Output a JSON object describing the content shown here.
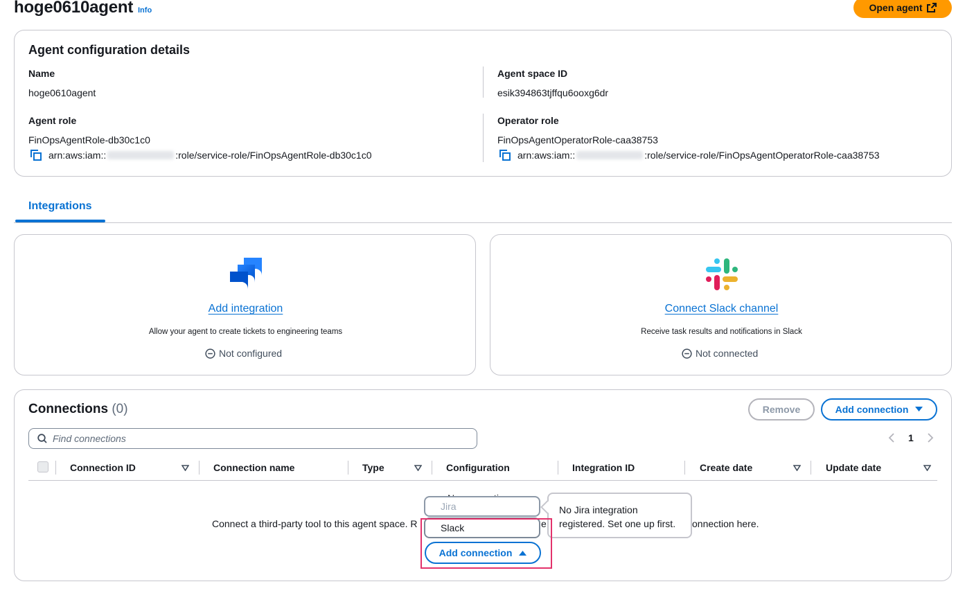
{
  "header": {
    "title": "hoge0610agent",
    "info_label": "Info",
    "open_agent_label": "Open agent"
  },
  "config": {
    "heading": "Agent configuration details",
    "name_label": "Name",
    "name_value": "hoge0610agent",
    "agent_space_id_label": "Agent space ID",
    "agent_space_id_value": "esik394863tjffqu6ooxg6dr",
    "agent_role_label": "Agent role",
    "agent_role_value": "FinOpsAgentRole-db30c1c0",
    "agent_role_arn_prefix": "arn:aws:iam::",
    "agent_role_arn_suffix": ":role/service-role/FinOpsAgentRole-db30c1c0",
    "operator_role_label": "Operator role",
    "operator_role_value": "FinOpsAgentOperatorRole-caa38753",
    "operator_role_arn_prefix": "arn:aws:iam::",
    "operator_role_arn_suffix": ":role/service-role/FinOpsAgentOperatorRole-caa38753"
  },
  "tabs": {
    "integrations_label": "Integrations"
  },
  "integrations": {
    "jira": {
      "link_label": "Add integration",
      "description": "Allow your agent to create tickets to engineering teams",
      "status": "Not configured"
    },
    "slack": {
      "link_label": "Connect Slack channel",
      "description": "Receive task results and notifications in Slack",
      "status": "Not connected"
    }
  },
  "connections": {
    "title": "Connections",
    "count": "(0)",
    "remove_label": "Remove",
    "add_label": "Add connection",
    "search_placeholder": "Find connections",
    "current_page": "1",
    "columns": [
      "Connection ID",
      "Connection name",
      "Type",
      "Configuration",
      "Integration ID",
      "Create date",
      "Update date"
    ],
    "empty_title_partial": "No connections",
    "empty_text_left": "Connect a third-party tool to this agent space. R",
    "empty_text_mid": "e",
    "empty_text_right": "onnection here.",
    "dropdown": {
      "options": [
        "Jira",
        "Slack"
      ],
      "tooltip": "No Jira integration registered. Set one up first."
    }
  },
  "colors": {
    "accent": "#0972d3",
    "primary_button": "#ff9900",
    "highlight": "#e3326b"
  }
}
